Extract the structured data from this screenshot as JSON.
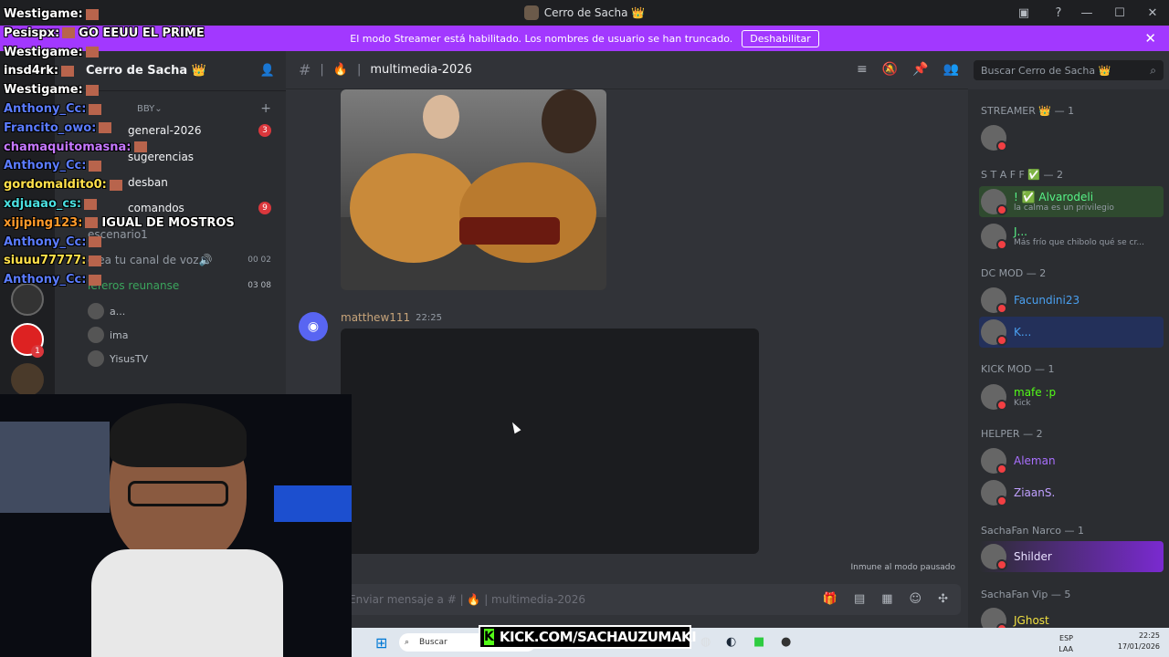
{
  "window": {
    "title": "Cerro de Sacha 👑"
  },
  "banner": {
    "message": "El modo Streamer está habilitado. Los nombres de usuario se han truncado.",
    "button": "Deshabilitar"
  },
  "server": {
    "name": "Cerro de Sacha 👑",
    "category": "BBY"
  },
  "channels": [
    {
      "name": "general-2026",
      "badge": "3"
    },
    {
      "name": "sugerencias",
      "badge": ""
    },
    {
      "name": "desban",
      "badge": ""
    },
    {
      "name": "comandos",
      "badge": "9"
    },
    {
      "name": "escenario1",
      "badge": ""
    },
    {
      "name": "crea tu canal de voz",
      "badge": "00 02"
    },
    {
      "name": "leferos reunanse",
      "badge": "03 08"
    }
  ],
  "voice_users": [
    "a...",
    "ima",
    "YisusTV"
  ],
  "guild_badge": "1",
  "chat": {
    "channel": "multimedia-2026",
    "message_author": "matthew111",
    "message_time": "22:25",
    "immune_note": "Inmune al modo pausado",
    "composer_placeholder": "Enviar mensaje a # | 🔥 | multimedia-2026"
  },
  "search": {
    "placeholder": "Buscar Cerro de Sacha 👑"
  },
  "members": {
    "roles": [
      {
        "label": "STREAMER 👑 — 1",
        "color": "#a970ff"
      },
      {
        "label": "S T A F F ✅ — 2",
        "color": "#57f287"
      },
      {
        "label": "DC MOD — 2",
        "color": "#5865f2"
      },
      {
        "label": "KICK MOD — 1",
        "color": "#53fc18"
      },
      {
        "label": "HELPER — 2",
        "color": "#e0a050"
      },
      {
        "label": "SachaFan Narco — 1",
        "color": "#c07040"
      },
      {
        "label": "SachaFan Vip — 5",
        "color": "#d07080"
      }
    ],
    "list": [
      {
        "name": "",
        "status": "",
        "color": "#e74c3c"
      },
      {
        "name": "! ✅ Alvarodeli",
        "status": "la calma es un privilegio",
        "color": "#57f287"
      },
      {
        "name": "J...",
        "status": "Más frío que chibolo qué se cr...",
        "color": "#57f287"
      },
      {
        "name": "Facundini23",
        "status": "",
        "color": "#4aa0f0"
      },
      {
        "name": "K...",
        "status": "",
        "color": "#4aa0f0"
      },
      {
        "name": "mafe :p",
        "status": "Kick",
        "color": "#53fc18"
      },
      {
        "name": "Aleman",
        "status": "",
        "color": "#a970ff"
      },
      {
        "name": "ZiaanS.",
        "status": "",
        "color": "#c0a0ff"
      },
      {
        "name": "Shilder",
        "status": "",
        "color": "#e8e0ff"
      },
      {
        "name": "JGhost",
        "status": "",
        "color": "#f0e040"
      }
    ]
  },
  "overlay_chat": [
    {
      "user": "Westigame:",
      "msg": "",
      "color": "#ffffff"
    },
    {
      "user": "Pesispx:",
      "msg": "GO EEUU EL PRIME",
      "color": "#ffffff"
    },
    {
      "user": "Westigame:",
      "msg": "",
      "color": "#ffffff"
    },
    {
      "user": "insd4rk:",
      "msg": "",
      "color": "#ffffff"
    },
    {
      "user": "Westigame:",
      "msg": "",
      "color": "#ffffff"
    },
    {
      "user": "Anthony_Cc:",
      "msg": "",
      "color": "#5b7cff"
    },
    {
      "user": "Francito_owo:",
      "msg": "",
      "color": "#5b7cff"
    },
    {
      "user": "chamaquitomasna:",
      "msg": "",
      "color": "#c678ff"
    },
    {
      "user": "Anthony_Cc:",
      "msg": "",
      "color": "#5b7cff"
    },
    {
      "user": "gordomaldito0:",
      "msg": "",
      "color": "#ffe04a"
    },
    {
      "user": "xdjuaao_cs:",
      "msg": "",
      "color": "#4adfe0"
    },
    {
      "user": "xijiping123:",
      "msg": "IGUAL DE MOSTROS",
      "color": "#ff9a2a"
    },
    {
      "user": "Anthony_Cc:",
      "msg": "",
      "color": "#5b7cff"
    },
    {
      "user": "siuuu77777:",
      "msg": "",
      "color": "#ffe04a"
    },
    {
      "user": "Anthony_Cc:",
      "msg": "",
      "color": "#5b7cff"
    }
  ],
  "taskbar": {
    "search": "Buscar",
    "lang": "ESP LAA",
    "time": "22:25",
    "date": "17/01/2026"
  },
  "kick_banner": "KICK.COM/SACHAUZUMAKI"
}
